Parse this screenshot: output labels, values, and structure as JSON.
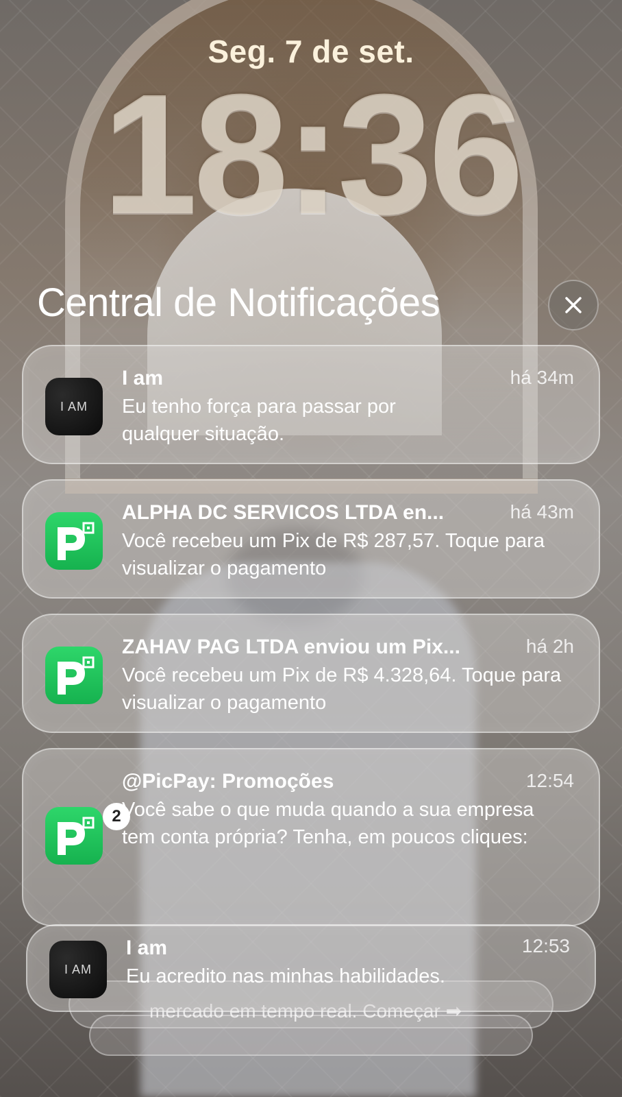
{
  "lockscreen": {
    "date": "Seg. 7 de set.",
    "time": "18:36"
  },
  "notification_center": {
    "title": "Central de Notificações",
    "close_icon": "close-icon"
  },
  "notifications": [
    {
      "app_icon": "i-am-app-icon",
      "app_icon_text": "I AM",
      "title": "I am",
      "time": "há 34m",
      "body": "Eu tenho força para passar por qualquer situação."
    },
    {
      "app_icon": "picpay-app-icon",
      "title": "ALPHA DC SERVICOS LTDA en...",
      "time": "há 43m",
      "body": "Você recebeu um Pix de R$ 287,57. Toque para visualizar o pagamento"
    },
    {
      "app_icon": "picpay-app-icon",
      "title": "ZAHAV PAG LTDA enviou um Pix...",
      "time": "há 2h",
      "body": "Você recebeu um Pix de R$ 4.328,64. Toque para visualizar o pagamento"
    },
    {
      "app_icon": "picpay-app-icon",
      "badge": "2",
      "title": "@PicPay: Promoções",
      "time": "12:54",
      "body": "Você sabe o que muda quando a sua empresa tem conta própria? Tenha, em poucos cliques:"
    },
    {
      "app_icon": "i-am-app-icon",
      "app_icon_text": "I AM",
      "title": "I am",
      "time": "12:53",
      "body": "Eu acredito nas minhas habilidades."
    }
  ],
  "stacked_hidden_text": "mercado em tempo real. Começar ➡"
}
